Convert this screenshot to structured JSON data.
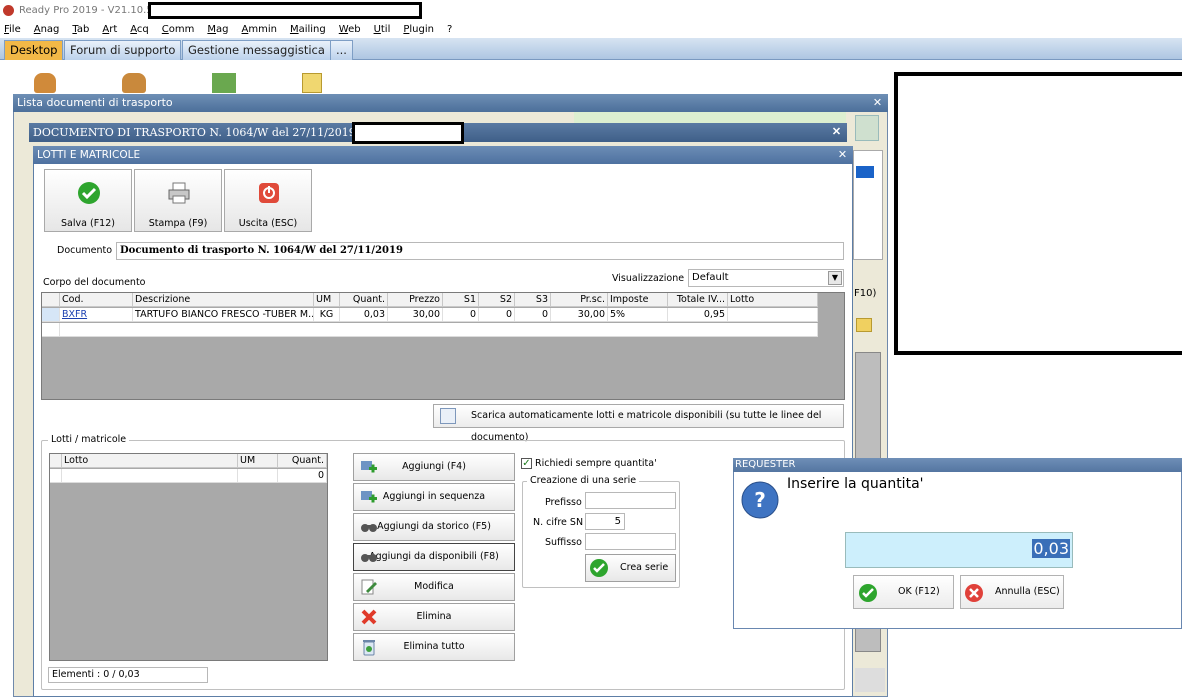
{
  "app": {
    "title": "Ready Pro 2019 - V21.10.5"
  },
  "menu": [
    "File",
    "Anag",
    "Tab",
    "Art",
    "Acq",
    "Comm",
    "Mag",
    "Ammin",
    "Mailing",
    "Web",
    "Util",
    "Plugin",
    "?"
  ],
  "desktop_tabs": [
    "Desktop",
    "Forum di supporto",
    "Gestione messaggistica",
    "..."
  ],
  "bg_window": {
    "title": "Lista documenti di trasporto",
    "side_f10": "F10)"
  },
  "doc_window": {
    "title": "DOCUMENTO DI TRASPORTO N. 1064/W del 27/11/2019"
  },
  "dialog": {
    "title": "LOTTI E MATRICOLE",
    "buttons": {
      "save": "Salva (F12)",
      "print": "Stampa (F9)",
      "exit": "Uscita (ESC)"
    },
    "document_label": "Documento :",
    "document_value": "Documento di trasporto N. 1064/W del 27/11/2019",
    "body_label": "Corpo del documento",
    "view_label": "Visualizzazione :",
    "view_value": "Default",
    "columns": [
      "Cod.",
      "Descrizione",
      "UM",
      "Quant.",
      "Prezzo",
      "S1",
      "S2",
      "S3",
      "Pr.sc.",
      "Imposte",
      "Totale IV...",
      "Lotto"
    ],
    "rows": [
      {
        "cod": "BXFR",
        "descrizione": "TARTUFO BIANCO FRESCO -TUBER M...",
        "um": "KG",
        "quant": "0,03",
        "prezzo": "30,00",
        "s1": "0",
        "s2": "0",
        "s3": "0",
        "prsc": "30,00",
        "imposte": "5%",
        "totale": "0,95",
        "lotto": ""
      }
    ],
    "auto_button": "Scarica automaticamente lotti e matricole disponibili (su tutte le linee del documento)",
    "lots_group": "Lotti / matricole",
    "lots_columns": [
      "Lotto",
      "UM",
      "Quant."
    ],
    "lots_row_quant": "0",
    "actions": [
      "Aggiungi (F4)",
      "Aggiungi in sequenza",
      "Aggiungi da storico (F5)",
      "Aggiungi da disponibili (F8)",
      "Modifica",
      "Elimina",
      "Elimina tutto"
    ],
    "always_qty_label": "Richiedi sempre quantita'",
    "series_group": "Creazione di una serie",
    "prefix_label": "Prefisso",
    "sn_digits_label": "N. cifre SN",
    "sn_digits_value": "5",
    "suffix_label": "Suffisso",
    "create_series": "Crea serie",
    "elements": "Elementi : 0 / 0,03"
  },
  "requester": {
    "title": "REQUESTER",
    "prompt": "Inserire la quantita'",
    "value": "0,03",
    "ok": "OK (F12)",
    "cancel": "Annulla (ESC)"
  }
}
